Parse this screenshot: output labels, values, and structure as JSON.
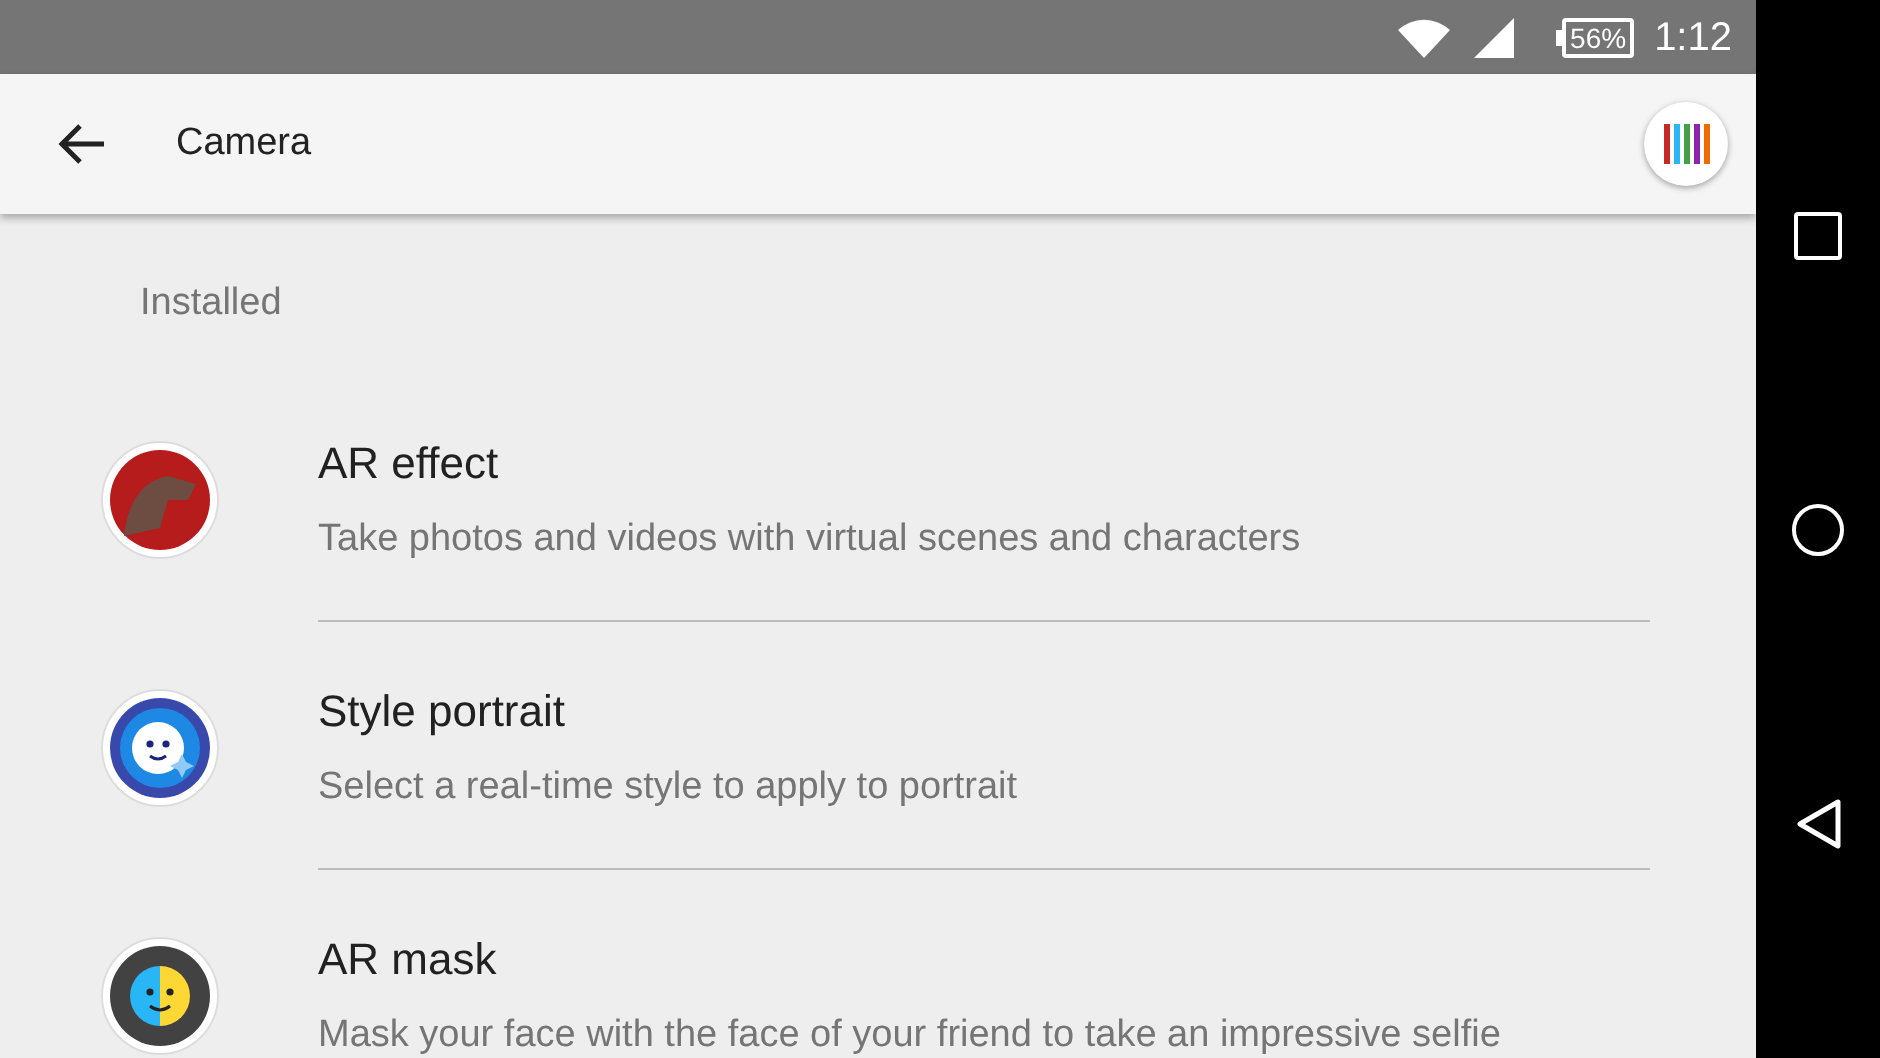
{
  "status_bar": {
    "battery": "56%",
    "time": "1:12"
  },
  "app_bar": {
    "title": "Camera"
  },
  "section": {
    "title": "Installed"
  },
  "items": [
    {
      "kind": "dinosaur",
      "title": "AR effect",
      "subtitle": "Take photos and videos with virtual scenes and characters"
    },
    {
      "kind": "style",
      "title": "Style portrait",
      "subtitle": "Select a real-time style to apply to portrait"
    },
    {
      "kind": "mask",
      "title": "AR mask",
      "subtitle": "Mask your face with the face of your friend to take an impressive selfie"
    }
  ]
}
